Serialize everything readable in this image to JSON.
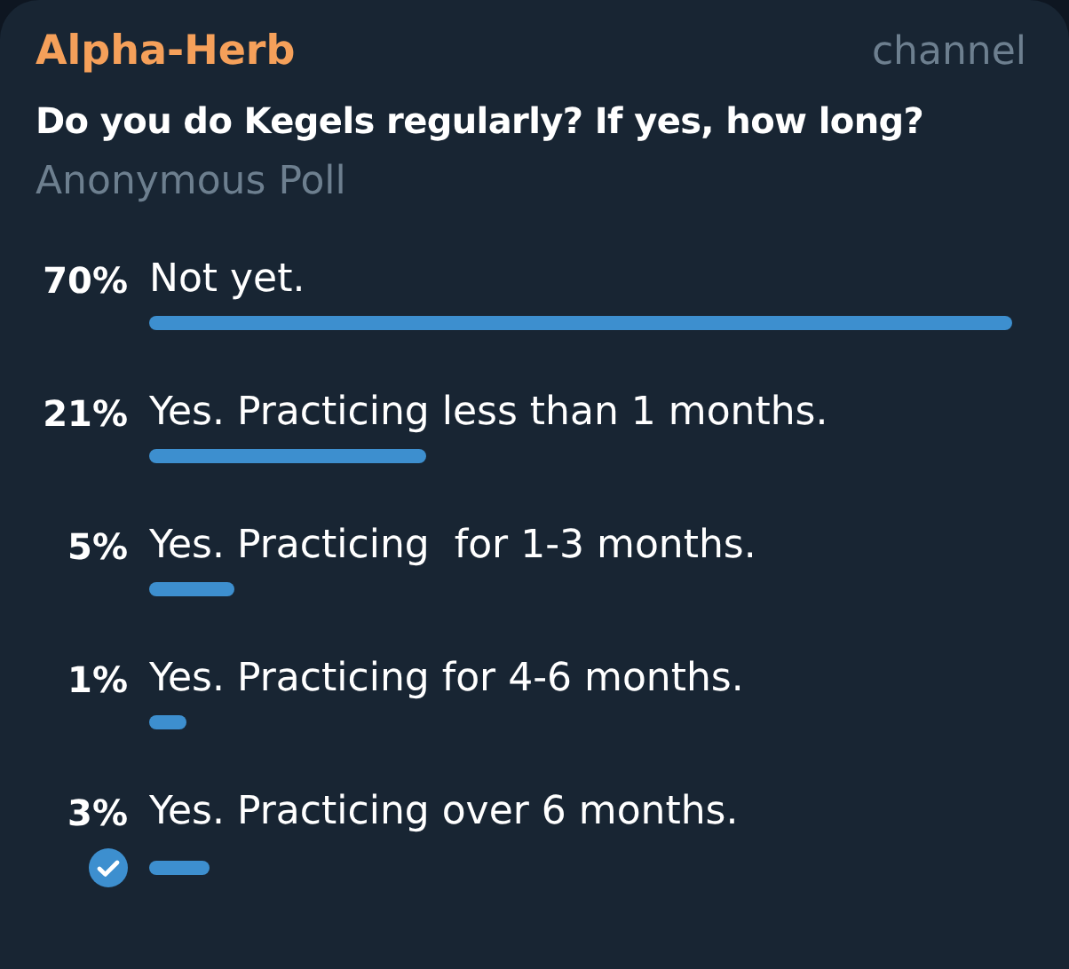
{
  "channel": {
    "name": "Alpha-Herb",
    "kind_label": "channel"
  },
  "poll": {
    "question": "Do you do Kegels regularly? If yes, how long?",
    "type_label": "Anonymous Poll",
    "options": [
      {
        "percent": "70%",
        "text": "Not yet.",
        "selected": false
      },
      {
        "percent": "21%",
        "text": "Yes. Practicing less than 1 months.",
        "selected": false
      },
      {
        "percent": "5%",
        "text": "Yes. Practicing  for 1-3 months.",
        "selected": false
      },
      {
        "percent": "1%",
        "text": "Yes. Practicing for 4-6 months.",
        "selected": false
      },
      {
        "percent": "3%",
        "text": "Yes. Practicing over 6 months.",
        "selected": true
      }
    ]
  }
}
